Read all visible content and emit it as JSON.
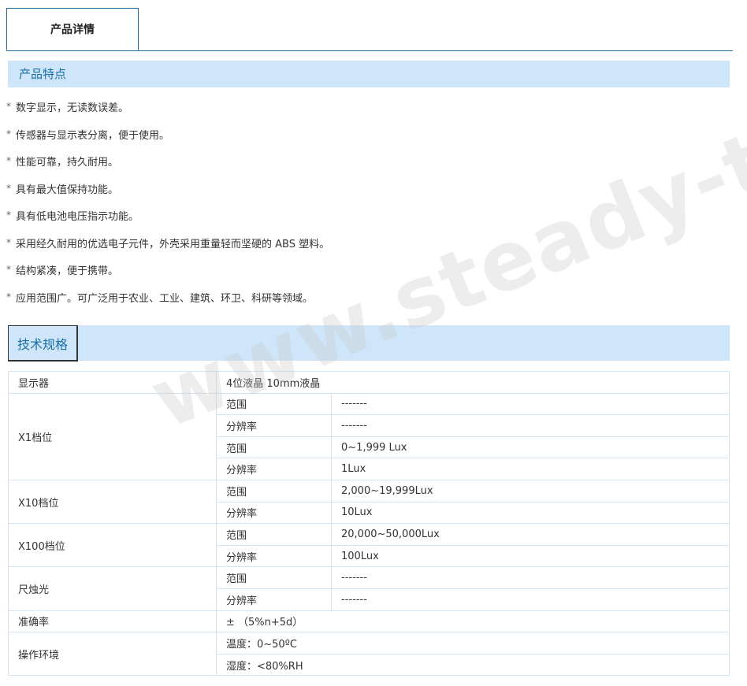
{
  "tab": {
    "label": "产品详情"
  },
  "features_title": "产品特点",
  "features": [
    "数字显示，无读数误差。",
    "传感器与显示表分离，便于使用。",
    "性能可靠，持久耐用。",
    "具有最大值保持功能。",
    "具有低电池电压指示功能。",
    "采用经久耐用的优选电子元件，外壳采用重量轻而坚硬的 ABS 塑料。",
    "结构紧凑，便于携带。",
    "应用范围广。可广泛用于农业、工业、建筑、环卫、科研等领域。"
  ],
  "bullet": "*",
  "specs_title": "技术规格",
  "specs": {
    "display": {
      "label": "显示器",
      "value": "4位液晶 10mm液晶"
    },
    "x1": {
      "label": "X1档位",
      "rows": [
        {
          "k": "范围",
          "v": "-------"
        },
        {
          "k": "分辨率",
          "v": "-------"
        },
        {
          "k": "范围",
          "v": "0~1,999 Lux"
        },
        {
          "k": "分辨率",
          "v": "1Lux"
        }
      ]
    },
    "x10": {
      "label": "X10档位",
      "rows": [
        {
          "k": "范围",
          "v": "2,000~19,999Lux"
        },
        {
          "k": "分辨率",
          "v": "10Lux"
        }
      ]
    },
    "x100": {
      "label": "X100档位",
      "rows": [
        {
          "k": "范围",
          "v": "20,000~50,000Lux"
        },
        {
          "k": "分辨率",
          "v": "100Lux"
        }
      ]
    },
    "candle": {
      "label": "尺烛光",
      "rows": [
        {
          "k": "范围",
          "v": "-------"
        },
        {
          "k": "分辨率",
          "v": "-------"
        }
      ]
    },
    "accuracy": {
      "label": "准确率",
      "value": "± （5%n+5d）"
    },
    "env": {
      "label": "操作环境",
      "rows": [
        {
          "v": "温度：0~50ºC"
        },
        {
          "v": "湿度：<80%RH"
        }
      ]
    }
  },
  "watermark": "www.steady-tech.com",
  "colors": {
    "section_bg": "#cfe6fa",
    "section_text": "#1a6fa8",
    "tab_border": "#1e6a9c",
    "table_border": "#d4e4f0"
  }
}
